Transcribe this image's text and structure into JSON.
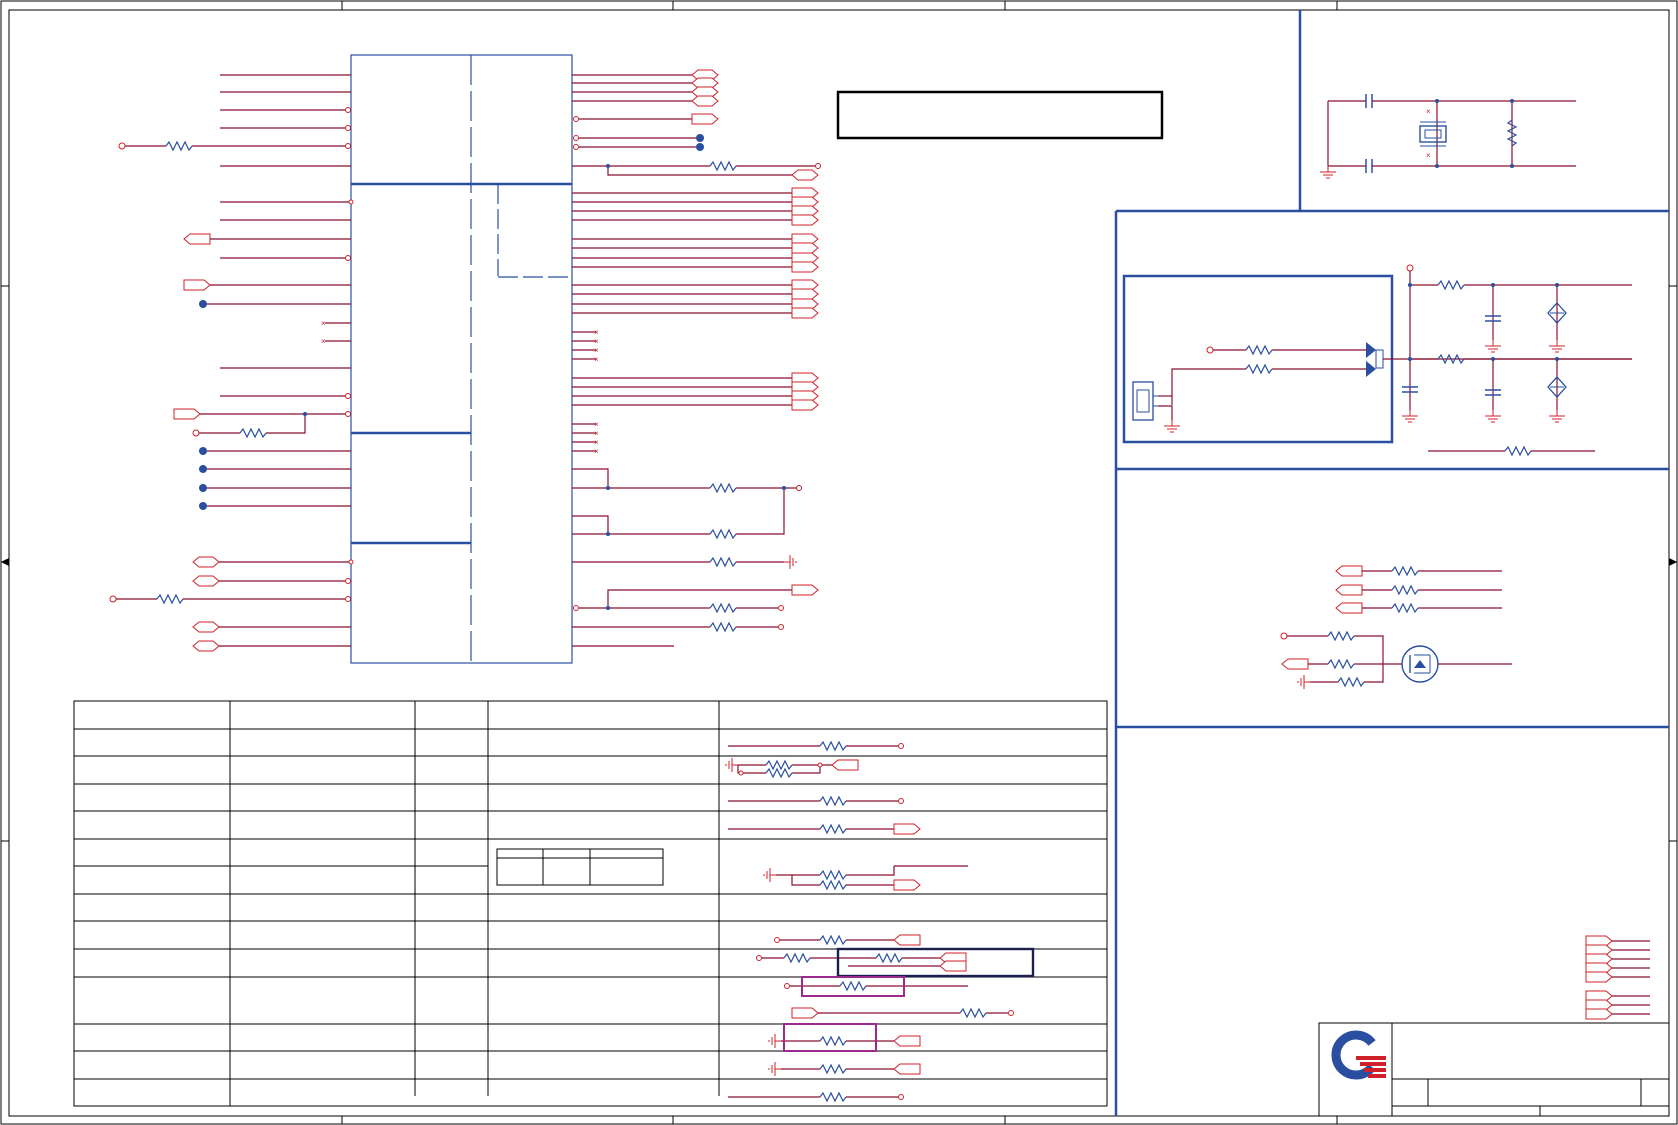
{
  "sheet": {
    "title": "",
    "logo": {
      "name": "quanta-style-logo",
      "colors": [
        "#2a4fa0",
        "#d0202a"
      ]
    }
  },
  "colors": {
    "net": "#d0202a",
    "component": "#2a4fa0",
    "frame": "#000000",
    "highlight_navy": "#1a1f4e",
    "highlight_purple": "#9b2a8c"
  },
  "icons": [
    "resistor-icon",
    "capacitor-icon",
    "crystal-icon",
    "mosfet-icon",
    "connector-icon",
    "ground-icon",
    "dual-diode-icon",
    "off-page-port-icon",
    "test-point-icon"
  ]
}
